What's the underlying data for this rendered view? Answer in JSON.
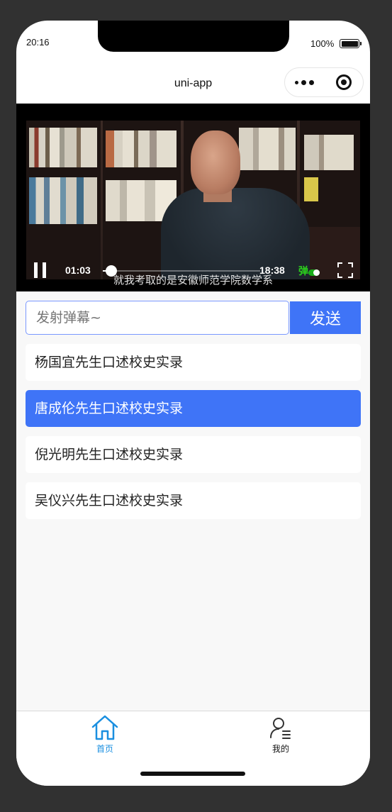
{
  "status_bar": {
    "time": "20:16",
    "battery": "100%"
  },
  "nav": {
    "title": "uni-app"
  },
  "video": {
    "current_time": "01:03",
    "total_time": "18:38",
    "progress": 0.056,
    "danmu_toggle_label": "弹",
    "subtitle": "就我考取的是安徽师范学院数学系"
  },
  "danmu": {
    "placeholder": "发射弹幕~",
    "send_label": "发送"
  },
  "list": {
    "items": [
      {
        "label": "杨国宜先生口述校史实录",
        "active": false
      },
      {
        "label": "唐成伦先生口述校史实录",
        "active": true
      },
      {
        "label": "倪光明先生口述校史实录",
        "active": false
      },
      {
        "label": "吴仪兴先生口述校史实录",
        "active": false
      }
    ]
  },
  "tabbar": {
    "home_label": "首页",
    "me_label": "我的",
    "home_icon": "home-icon",
    "me_icon": "user-icon",
    "active_color": "#1a8fe0"
  },
  "colors": {
    "accent": "#3f74f7",
    "background": "#f8f8f8"
  }
}
